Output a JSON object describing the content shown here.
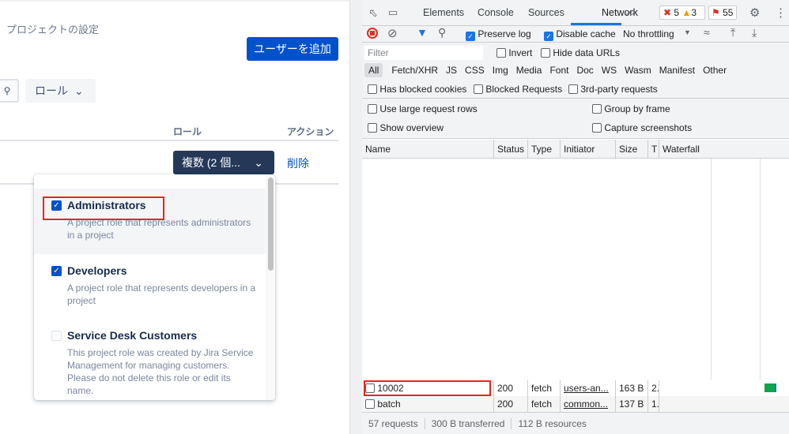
{
  "left": {
    "breadcrumb": "プロジェクトの設定",
    "add_user_button": "ユーザーを追加",
    "role_filter": "ロール",
    "columns": {
      "role": "ロール",
      "action": "アクション"
    },
    "row": {
      "role_select": "複数 (2 個...",
      "delete": "削除"
    },
    "role_options": [
      {
        "title": "Administrators",
        "checked": true,
        "description": "A project role that represents administrators in a project"
      },
      {
        "title": "Developers",
        "checked": true,
        "description": "A project role that represents developers in a project"
      },
      {
        "title": "Service Desk Customers",
        "checked": false,
        "description": "This project role was created by Jira Service Management for managing customers. Please do not delete this role or edit its name."
      }
    ]
  },
  "devtools": {
    "tabs": [
      "Elements",
      "Console",
      "Sources",
      "Network"
    ],
    "active_tab": "Network",
    "more": ">>",
    "counts": {
      "errors": "5",
      "warnings": "3",
      "issues": "55"
    },
    "toolbar": {
      "preserve_log": "Preserve log",
      "disable_cache": "Disable cache",
      "throttling": "No throttling"
    },
    "filter": {
      "placeholder": "Filter",
      "invert": "Invert",
      "hide_data_urls": "Hide data URLs"
    },
    "types": [
      "All",
      "Fetch/XHR",
      "JS",
      "CSS",
      "Img",
      "Media",
      "Font",
      "Doc",
      "WS",
      "Wasm",
      "Manifest",
      "Other"
    ],
    "blocked": {
      "has_blocked_cookies": "Has blocked cookies",
      "blocked_requests": "Blocked Requests",
      "third_party": "3rd-party requests"
    },
    "settings": {
      "large_rows": "Use large request rows",
      "group_by_frame": "Group by frame",
      "show_overview": "Show overview",
      "capture_screenshots": "Capture screenshots"
    },
    "columns": [
      "Name",
      "Status",
      "Type",
      "Initiator",
      "Size",
      "T",
      "Waterfall"
    ],
    "requests": [
      {
        "name": "10002",
        "status": "200",
        "type": "fetch",
        "initiator": "users-an...",
        "size": "163 B",
        "time": "2."
      },
      {
        "name": "batch",
        "status": "200",
        "type": "fetch",
        "initiator": "common...",
        "size": "137 B",
        "time": "1."
      }
    ],
    "status_bar": {
      "requests": "57 requests",
      "transferred": "300 B transferred",
      "resources": "112 B resources"
    }
  }
}
